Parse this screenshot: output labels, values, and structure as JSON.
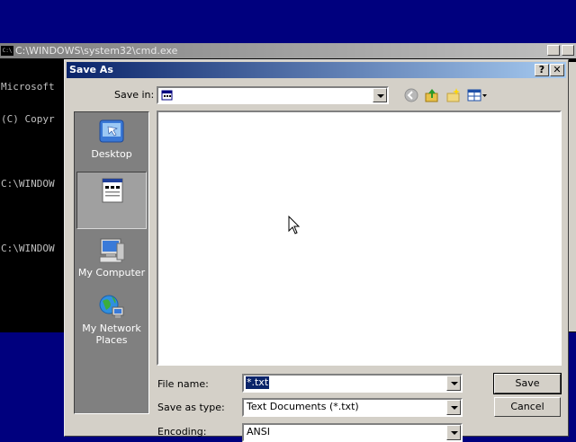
{
  "cmd": {
    "title": "C:\\WINDOWS\\system32\\cmd.exe",
    "icon_text": "C:\\",
    "lines": [
      "Microsoft",
      "(C) Copyr",
      "",
      "C:\\WINDOW",
      "",
      "C:\\WINDOW"
    ]
  },
  "dialog": {
    "title": "Save As",
    "help_btn": "?",
    "close_btn": "✕",
    "save_in_label": "Save in:",
    "save_in_value": "",
    "toolbar_icons": [
      "back-icon",
      "up-folder-icon",
      "new-folder-icon",
      "views-menu-icon"
    ],
    "places": [
      {
        "label": "Desktop",
        "icon": "desktop-icon",
        "selected": false
      },
      {
        "label": "",
        "icon": "document-icon",
        "selected": true
      },
      {
        "label": "My Computer",
        "icon": "my-computer-icon",
        "selected": false
      },
      {
        "label": "My Network Places",
        "icon": "network-icon",
        "selected": false
      }
    ],
    "file_name_label": "File name:",
    "file_name_value": "*.txt",
    "save_type_label": "Save as type:",
    "save_type_value": "Text Documents (*.txt)",
    "encoding_label": "Encoding:",
    "encoding_value": "ANSI",
    "save_button": "Save",
    "cancel_button": "Cancel"
  }
}
